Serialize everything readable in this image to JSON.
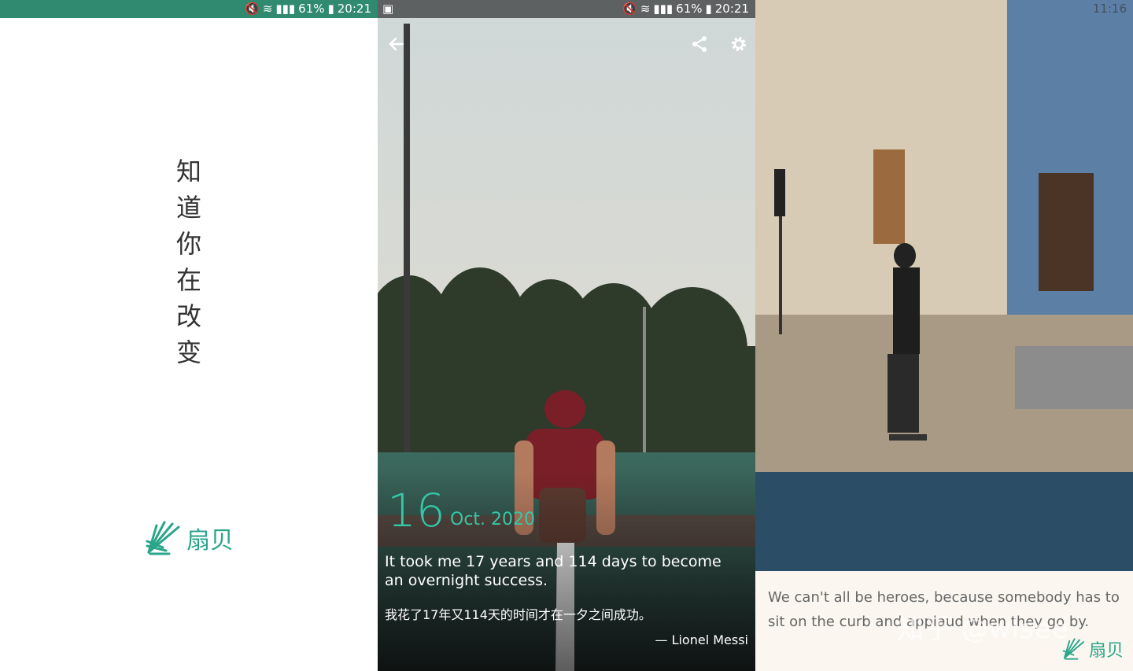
{
  "panel1": {
    "status": {
      "battery": "61%",
      "time": "20:21"
    },
    "slogan_chars": [
      "知",
      "道",
      "你",
      "在",
      "改",
      "变"
    ],
    "logo_text": "扇贝",
    "brand_color": "#2aa58a"
  },
  "panel2": {
    "status": {
      "battery": "61%",
      "time": "20:21"
    },
    "date_day": "16",
    "date_month_year": "Oct. 2020",
    "quote_en": "It took me 17 years and 114 days to become an overnight success.",
    "quote_zh": "我花了17年又114天的时间才在一夕之间成功。",
    "author": "— Lionel Messi",
    "icons": [
      "back-arrow-icon",
      "share-icon",
      "gear-icon"
    ],
    "accent_color": "#35c7a7"
  },
  "panel3": {
    "status": {
      "time": "11:16"
    },
    "quote_en": "We can't all be heroes, because somebody has to sit on the curb and applaud when they go by.",
    "logo_text": "扇贝",
    "watermark": "知乎 @wlsee"
  }
}
